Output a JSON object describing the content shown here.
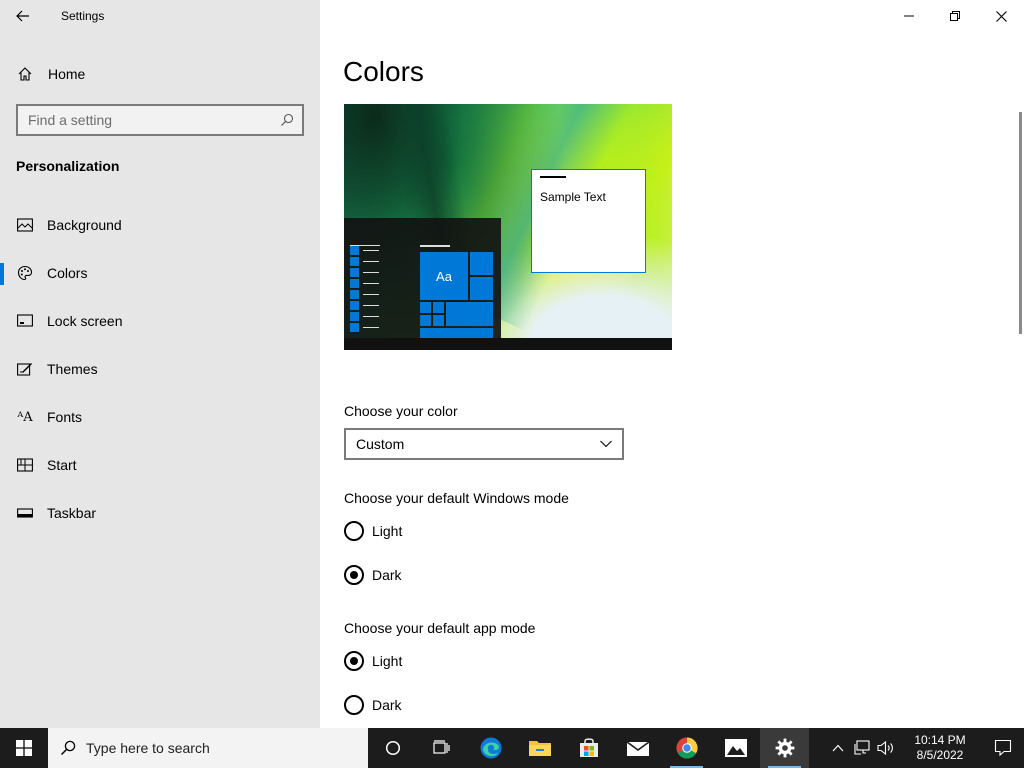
{
  "window": {
    "app_title": "Settings"
  },
  "sidebar": {
    "home_label": "Home",
    "search_placeholder": "Find a setting",
    "section_title": "Personalization",
    "items": [
      {
        "label": "Background",
        "icon": "picture-icon",
        "selected": false
      },
      {
        "label": "Colors",
        "icon": "palette-icon",
        "selected": true
      },
      {
        "label": "Lock screen",
        "icon": "lock-screen-icon",
        "selected": false
      },
      {
        "label": "Themes",
        "icon": "themes-icon",
        "selected": false
      },
      {
        "label": "Fonts",
        "icon": "fonts-icon",
        "selected": false
      },
      {
        "label": "Start",
        "icon": "start-icon",
        "selected": false
      },
      {
        "label": "Taskbar",
        "icon": "taskbar-icon",
        "selected": false
      }
    ]
  },
  "main": {
    "title": "Colors",
    "preview": {
      "sample_text": "Sample Text",
      "tile_text": "Aa"
    },
    "choose_color": {
      "label": "Choose your color",
      "value": "Custom"
    },
    "windows_mode": {
      "label": "Choose your default Windows mode",
      "options": [
        {
          "label": "Light",
          "checked": false
        },
        {
          "label": "Dark",
          "checked": true
        }
      ]
    },
    "app_mode": {
      "label": "Choose your default app mode",
      "options": [
        {
          "label": "Light",
          "checked": true
        },
        {
          "label": "Dark",
          "checked": false
        }
      ]
    }
  },
  "taskbar": {
    "search_placeholder": "Type here to search",
    "apps": [
      "task-view-icon",
      "edge-icon",
      "file-explorer-icon",
      "store-icon",
      "mail-icon",
      "chrome-icon",
      "photos-icon",
      "settings-icon"
    ],
    "clock_time": "10:14 PM",
    "clock_date": "8/5/2022"
  },
  "colors": {
    "accent": "#0078d7",
    "sidebar_bg": "#e6e6e6",
    "taskbar_bg": "#1c1c1c"
  }
}
